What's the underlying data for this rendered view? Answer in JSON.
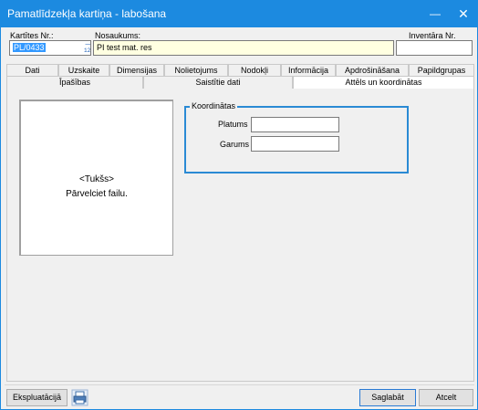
{
  "window": {
    "title": "Pamatlīdzekļa kartiņa - labošana",
    "min_glyph": "—",
    "close_glyph": "✕"
  },
  "header": {
    "card_no_label": "Kartītes Nr.:",
    "card_no_value": "PL/0433",
    "numbering_icon": "auto-number-icon",
    "numbering_digits": "123",
    "numbering_arrow": "⟶",
    "name_label": "Nosaukums:",
    "name_value": "PI test mat. res",
    "inventory_label": "Inventāra Nr.",
    "inventory_value": ""
  },
  "tabs_row1": [
    "Dati",
    "Uzskaite",
    "Dimensijas",
    "Nolietojums",
    "Nodokļi",
    "Informācija",
    "Apdrošināšana",
    "Papildgrupas"
  ],
  "tabs_row2": [
    "Īpašības",
    "Saistītie dati",
    "Attēls un koordinātas"
  ],
  "active_tab": "Attēls un koordinātas",
  "image_drop": {
    "empty_text": "<Tukšs>",
    "hint_text": "Pārvelciet failu."
  },
  "coordinates": {
    "legend": "Koordinātas",
    "latitude_label": "Platums",
    "latitude_value": "",
    "longitude_label": "Garums",
    "longitude_value": ""
  },
  "footer": {
    "exploitation_label": "Ekspluatācijā",
    "print_icon": "printer-icon",
    "save_label": "Saglabāt",
    "cancel_label": "Atcelt"
  },
  "colors": {
    "titlebar": "#1c8ae0",
    "group_border": "#2a8ad4",
    "selection": "#3399ff",
    "name_field_bg": "#ffffe1"
  }
}
